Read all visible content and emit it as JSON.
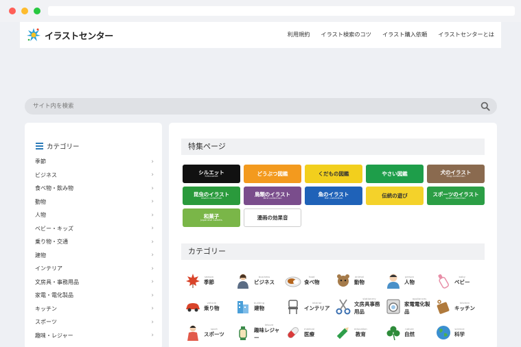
{
  "browser": {},
  "header": {
    "logo_text": "イラストセンター",
    "nav": [
      "利用規約",
      "イラスト検索のコツ",
      "イラスト購入依頼",
      "イラストセンターとは"
    ]
  },
  "search": {
    "placeholder": "サイト内を検索"
  },
  "sidebar": {
    "title": "カテゴリー",
    "items": [
      "季節",
      "ビジネス",
      "食べ物・飲み物",
      "動物",
      "人物",
      "ベビー・キッズ",
      "乗り物・交通",
      "建物",
      "インテリア",
      "文房具・事務用品",
      "家電・電化製品",
      "キッチン",
      "スポーツ",
      "趣味・レジャー"
    ]
  },
  "featured": {
    "title": "特集ページ",
    "banners": [
      {
        "label": "シルエット",
        "sub": "Silhouette",
        "color": "#111111"
      },
      {
        "label": "どうぶつ図鑑",
        "sub": "",
        "color": "#f39a1e"
      },
      {
        "label": "くだもの図鑑",
        "sub": "",
        "color": "#f2cf1d"
      },
      {
        "label": "やさい図鑑",
        "sub": "",
        "color": "#1e9e4a"
      },
      {
        "label": "犬のイラスト",
        "sub": "Dog collection",
        "color": "#8a6a4f"
      },
      {
        "label": "昆虫のイラスト",
        "sub": "insect collection",
        "color": "#2a9a3c"
      },
      {
        "label": "鳥類のイラスト",
        "sub": "Bird collection",
        "color": "#7a4d8c"
      },
      {
        "label": "魚のイラスト",
        "sub": "fish collection",
        "color": "#1f62b8"
      },
      {
        "label": "伝統の遊び",
        "sub": "",
        "color": "#f4d22a"
      },
      {
        "label": "スポーツのイラスト",
        "sub": "sport collection",
        "color": "#2b9e45"
      },
      {
        "label": "和菓子",
        "sub": "Japanese sweets",
        "color": "#7ab648"
      },
      {
        "label": "漫画の効果音",
        "sub": "",
        "color": "#ffffff"
      }
    ]
  },
  "categories": {
    "title": "カテゴリー",
    "items": [
      {
        "en": "season",
        "ja": "季節",
        "icon": "maple-leaf-icon",
        "color": "#d9442a"
      },
      {
        "en": "business",
        "ja": "ビジネス",
        "icon": "businesswoman-icon",
        "color": "#5b6d85"
      },
      {
        "en": "food",
        "ja": "食べ物",
        "icon": "curry-plate-icon",
        "color": "#b5651d"
      },
      {
        "en": "animal",
        "ja": "動物",
        "icon": "animal-icon",
        "color": "#a57b4a"
      },
      {
        "en": "person",
        "ja": "人物",
        "icon": "person-icon",
        "color": "#4a90c8"
      },
      {
        "en": "baby",
        "ja": "ベビー",
        "icon": "baby-bottle-icon",
        "color": "#e88fa8"
      },
      {
        "en": "vehicle",
        "ja": "乗り物",
        "icon": "car-icon",
        "color": "#d9442a"
      },
      {
        "en": "building",
        "ja": "建物",
        "icon": "building-icon",
        "color": "#4a9fd8"
      },
      {
        "en": "interior",
        "ja": "インテリア",
        "icon": "chair-icon",
        "color": "#666666"
      },
      {
        "en": "stationery",
        "ja": "文房具事務用品",
        "icon": "scissors-icon",
        "color": "#3a6fb0"
      },
      {
        "en": "appliances",
        "ja": "家電電化製品",
        "icon": "washing-machine-icon",
        "color": "#777777"
      },
      {
        "en": "kitchen",
        "ja": "キッチン",
        "icon": "cutting-board-icon",
        "color": "#b07a3c"
      },
      {
        "en": "sport",
        "ja": "スポーツ",
        "icon": "athlete-icon",
        "color": "#e25a4a"
      },
      {
        "en": "leisure",
        "ja": "趣味レジャー",
        "icon": "lantern-icon",
        "color": "#3a8a4a"
      },
      {
        "en": "medical",
        "ja": "医療",
        "icon": "capsule-icon",
        "color": "#d93a3a"
      },
      {
        "en": "education",
        "ja": "教育",
        "icon": "pencil-icon",
        "color": "#2e9e4a"
      },
      {
        "en": "nature",
        "ja": "自然",
        "icon": "clover-icon",
        "color": "#2e8b3a"
      },
      {
        "en": "science",
        "ja": "科学",
        "icon": "earth-icon",
        "color": "#3a8fd0"
      }
    ]
  }
}
